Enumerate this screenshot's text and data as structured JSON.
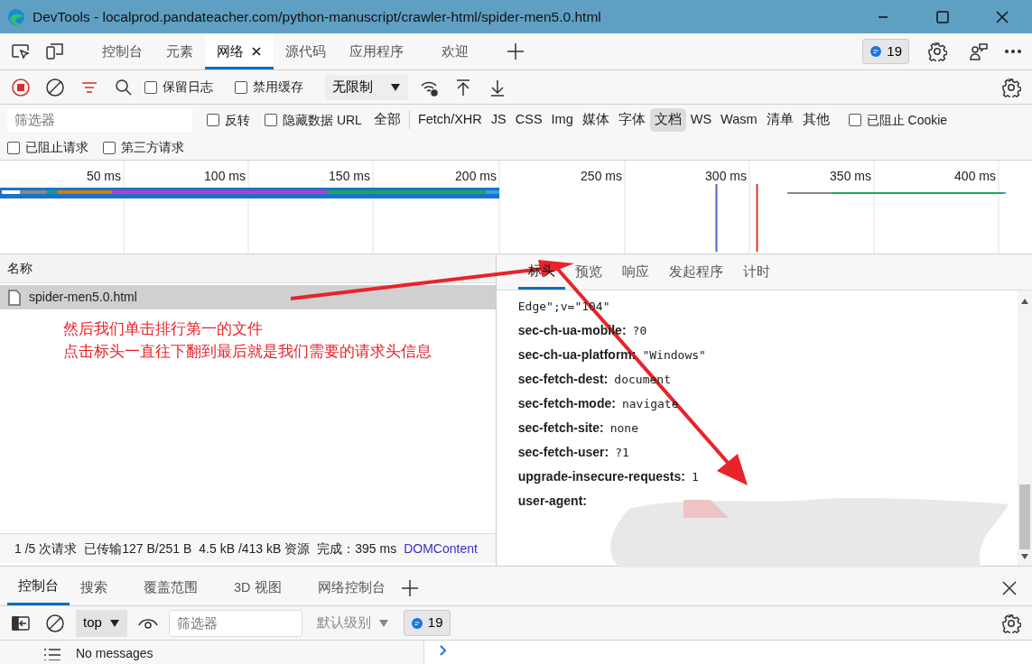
{
  "window": {
    "title": "DevTools - localprod.pandateacher.com/python-manuscript/crawler-html/spider-men5.0.html"
  },
  "top_tabs": [
    {
      "label": "控制台",
      "selected": false,
      "closable": false
    },
    {
      "label": "元素",
      "selected": false,
      "closable": false
    },
    {
      "label": "网络",
      "selected": true,
      "closable": true
    },
    {
      "label": "源代码",
      "selected": false,
      "closable": false
    },
    {
      "label": "应用程序",
      "selected": false,
      "closable": false
    },
    {
      "label": "欢迎",
      "selected": false,
      "closable": false
    }
  ],
  "issues_badge": "19",
  "toolbar": {
    "recording": true,
    "checkboxes": [
      {
        "label": "保留日志",
        "checked": false
      },
      {
        "label": "禁用缓存",
        "checked": false
      }
    ],
    "throttle": "无限制"
  },
  "filter": {
    "placeholder": "筛选器",
    "checkboxes": [
      {
        "label": "反转",
        "checked": false
      },
      {
        "label": "隐藏数据 URL",
        "checked": false
      }
    ],
    "types": [
      {
        "label": "全部",
        "selected": false
      },
      {
        "label": "Fetch/XHR",
        "selected": false
      },
      {
        "label": "JS",
        "selected": false
      },
      {
        "label": "CSS",
        "selected": false
      },
      {
        "label": "Img",
        "selected": false
      },
      {
        "label": "媒体",
        "selected": false
      },
      {
        "label": "字体",
        "selected": false
      },
      {
        "label": "文档",
        "selected": true
      },
      {
        "label": "WS",
        "selected": false
      },
      {
        "label": "Wasm",
        "selected": false
      },
      {
        "label": "清单",
        "selected": false
      },
      {
        "label": "其他",
        "selected": false
      }
    ],
    "blocked_cookies": {
      "label": "已阻止 Cookie",
      "checked": false
    },
    "more_checkboxes": [
      {
        "label": "已阻止请求",
        "checked": false
      },
      {
        "label": "第三方请求",
        "checked": false
      }
    ]
  },
  "timeline": {
    "ticks": [
      "50 ms",
      "100 ms",
      "150 ms",
      "200 ms",
      "250 ms",
      "300 ms",
      "350 ms",
      "400 ms"
    ]
  },
  "requests": {
    "column": "名称",
    "rows": [
      {
        "name": "spider-men5.0.html",
        "selected": true
      }
    ]
  },
  "status_bar": [
    "1 /5 次请求",
    "已传输127 B/251 B",
    "4.5 kB /413 kB 资源",
    "完成：395 ms"
  ],
  "status_link": "DOMContent",
  "detail_tabs": [
    {
      "label": "标头",
      "selected": true
    },
    {
      "label": "预览",
      "selected": false
    },
    {
      "label": "响应",
      "selected": false
    },
    {
      "label": "发起程序",
      "selected": false
    },
    {
      "label": "计时",
      "selected": false
    }
  ],
  "headers": {
    "continued": "Edge\";v=\"104\"",
    "items": [
      {
        "name": "sec-ch-ua-mobile:",
        "value": "?0",
        "redacted": false
      },
      {
        "name": "sec-ch-ua-platform:",
        "value": "\"Windows\"",
        "redacted": false
      },
      {
        "name": "sec-fetch-dest:",
        "value": "document",
        "redacted": false
      },
      {
        "name": "sec-fetch-mode:",
        "value": "navigate",
        "redacted": false
      },
      {
        "name": "sec-fetch-site:",
        "value": "none",
        "redacted": false
      },
      {
        "name": "sec-fetch-user:",
        "value": "?1",
        "redacted": false
      },
      {
        "name": "upgrade-insecure-requests:",
        "value": "1",
        "redacted": false
      },
      {
        "name": "user-agent:",
        "value": "",
        "redacted": true
      }
    ]
  },
  "annotation": [
    "然后我们单击排行第一的文件",
    "点击标头一直往下翻到最后就是我们需要的请求头信息"
  ],
  "drawer_tabs": [
    {
      "label": "控制台",
      "selected": true
    },
    {
      "label": "搜索",
      "selected": false
    },
    {
      "label": "覆盖范围",
      "selected": false
    },
    {
      "label": "3D 视图",
      "selected": false
    },
    {
      "label": "网络控制台",
      "selected": false
    }
  ],
  "console": {
    "context": "top",
    "filter_placeholder": "筛选器",
    "level": "默认级别",
    "issues_badge": "19",
    "sidebar_label": "No messages"
  }
}
